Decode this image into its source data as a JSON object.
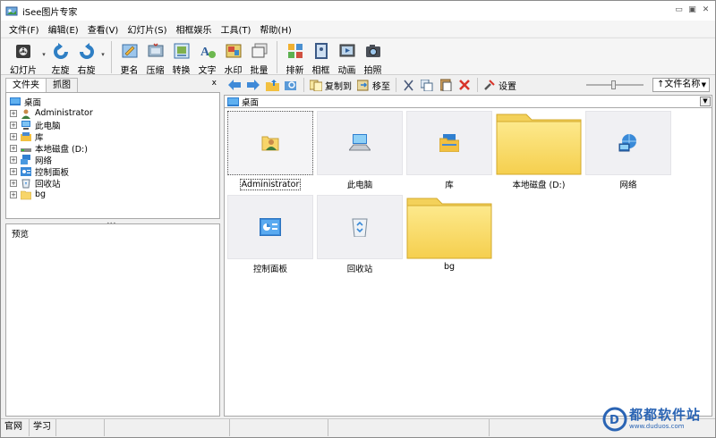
{
  "window": {
    "title": "iSee图片专家"
  },
  "menu": [
    "文件(F)",
    "编辑(E)",
    "查看(V)",
    "幻灯片(S)",
    "相框娱乐",
    "工具(T)",
    "帮助(H)"
  ],
  "toolbar": {
    "slideshow": "幻灯片",
    "rotate_left": "左旋",
    "rotate_right": "右旋",
    "rename": "更名",
    "compress": "压缩",
    "convert": "转换",
    "text": "文字",
    "watermark": "水印",
    "batch": "批量",
    "arrange": "排新",
    "frame": "相框",
    "animation": "动画",
    "capture": "拍照"
  },
  "left_tabs": {
    "folders": "文件夹",
    "album": "抓图",
    "close": "x"
  },
  "tree": {
    "root": "桌面",
    "items": [
      "Administrator",
      "此电脑",
      "库",
      "本地磁盘 (D:)",
      "网络",
      "控制面板",
      "回收站",
      "bg"
    ]
  },
  "preview": {
    "label": "预览"
  },
  "right_toolbar": {
    "copy_to": "复制到",
    "move_to": "移至",
    "settings": "设置",
    "sort": "↑文件名称"
  },
  "address": {
    "path": "桌面"
  },
  "thumbnails": [
    {
      "label": "Administrator",
      "icon": "user-folder-icon"
    },
    {
      "label": "此电脑",
      "icon": "computer-icon"
    },
    {
      "label": "库",
      "icon": "library-icon"
    },
    {
      "label": "本地磁盘 (D:)",
      "icon": "folder-icon"
    },
    {
      "label": "网络",
      "icon": "network-icon"
    },
    {
      "label": "控制面板",
      "icon": "control-panel-icon"
    },
    {
      "label": "回收站",
      "icon": "recycle-bin-icon"
    },
    {
      "label": "bg",
      "icon": "folder-icon"
    }
  ],
  "status": {
    "website": "官网",
    "learn": "学习"
  },
  "brand_watermark": {
    "name": "都都软件站",
    "url": "www.duduos.com"
  },
  "colors": {
    "folder": "#fbd860",
    "accent": "#2a64b4"
  }
}
